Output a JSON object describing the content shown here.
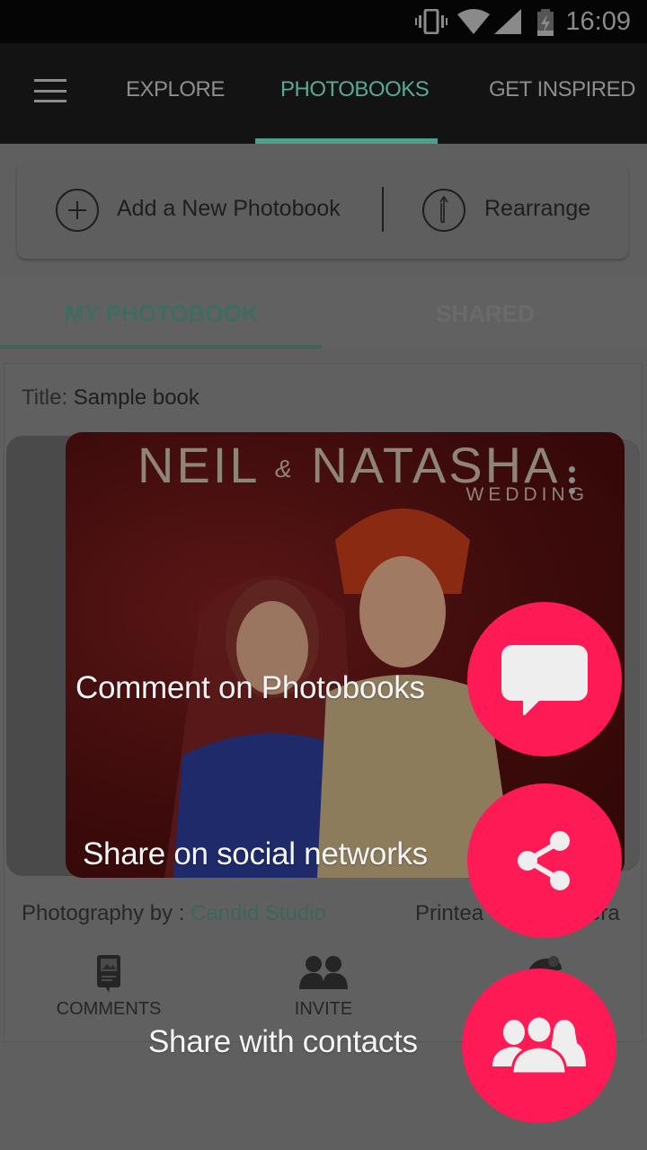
{
  "status_bar": {
    "time": "16:09",
    "icons": [
      "vibrate-icon",
      "wifi-icon",
      "signal-icon",
      "battery-charging-icon"
    ]
  },
  "app_bar": {
    "menu_icon": "hamburger-menu-icon",
    "tabs": [
      {
        "label": "EXPLORE",
        "active": false
      },
      {
        "label": "PHOTOBOOKS",
        "active": true
      },
      {
        "label": "GET INSPIRED",
        "active": false
      }
    ],
    "accent_color": "#5aa896"
  },
  "actions": {
    "add_label": "Add a New Photobook",
    "add_icon": "plus-circle-icon",
    "rearrange_label": "Rearrange",
    "rearrange_icon": "rearrange-arrows-icon"
  },
  "sub_tabs": [
    {
      "label": "MY PHOTOBOOK",
      "active": true
    },
    {
      "label": "SHARED",
      "active": false
    }
  ],
  "book": {
    "title_label": "Title:",
    "title_value": "Sample book",
    "cover_title_left": "NEIL",
    "cover_title_amp": "&",
    "cover_title_right": "NATASHA",
    "cover_subtitle": "WEDDING",
    "photography_label": "Photography by :",
    "photography_value": "Candid  Studio",
    "printed_label_partial": "Printea",
    "printed_value_partial": "era",
    "bottom_actions": [
      {
        "label": "COMMENTS",
        "icon": "comments-book-icon"
      },
      {
        "label": "INVITE",
        "icon": "invite-people-icon"
      },
      {
        "label": "",
        "icon": "globe-icon"
      }
    ]
  },
  "overlay": {
    "fab_color": "#fe1a55",
    "items": [
      {
        "label": "Comment on Photobooks",
        "icon": "comment-bubble-icon"
      },
      {
        "label": "Share on social networks",
        "icon": "share-icon"
      },
      {
        "label": "Share with contacts",
        "icon": "contacts-group-icon"
      }
    ]
  }
}
